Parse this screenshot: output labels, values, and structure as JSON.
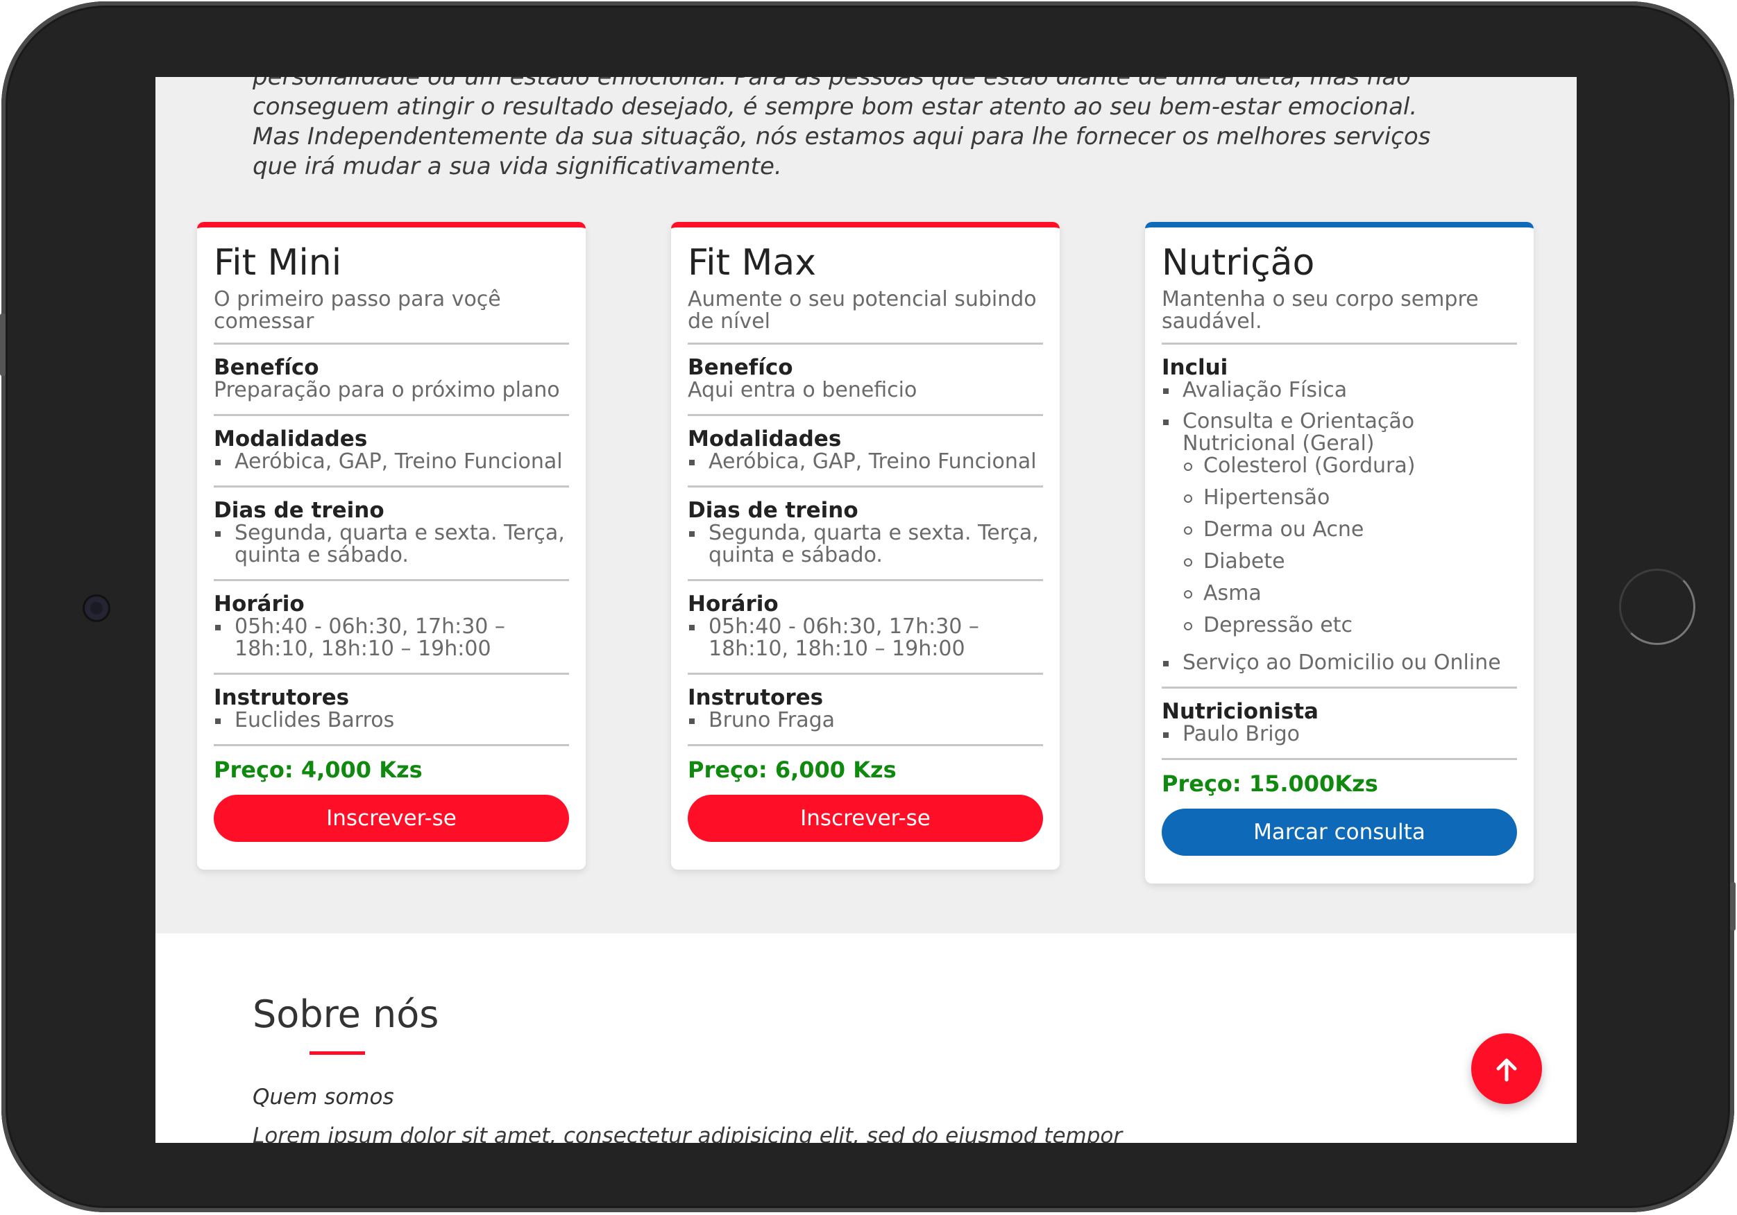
{
  "intro": {
    "lines": [
      "personalidade ou um estado emocional. Para as pessoas que estão diante de uma dieta, mas não",
      "conseguem atingir o resultado desejado, é sempre bom estar atento ao seu bem-estar emocional.",
      "Mas Independentemente da sua situação, nós estamos aqui para lhe fornecer os melhores serviços",
      "que irá mudar a sua vida significativamente."
    ]
  },
  "plans": [
    {
      "title": "Fit Mini",
      "subtitle": "O primeiro passo para voçê comessar",
      "benefit_heading": "Benefíco",
      "benefit_text": "Preparação para o próximo plano",
      "modalities_heading": "Modalidades",
      "modalities": "Aeróbica, GAP, Treino Funcional",
      "days_heading": "Dias de treino",
      "days": "Segunda, quarta e sexta. Terça, quinta e sábado.",
      "hours_heading": "Horário",
      "hours": "05h:40 - 06h:30, 17h:30 – 18h:10, 18h:10 – 19h:00",
      "instructors_heading": "Instrutores",
      "instructor": "Euclides Barros",
      "price": "Preço: 4,000 Kzs",
      "button": "Inscrever-se",
      "accent": "#ff0f27"
    },
    {
      "title": "Fit Max",
      "subtitle": "Aumente o seu potencial subindo de nível",
      "benefit_heading": "Benefíco",
      "benefit_text": "Aqui entra o beneficio",
      "modalities_heading": "Modalidades",
      "modalities": "Aeróbica, GAP, Treino Funcional",
      "days_heading": "Dias de treino",
      "days": "Segunda, quarta e sexta. Terça, quinta e sábado.",
      "hours_heading": "Horário",
      "hours": "05h:40 - 06h:30, 17h:30 – 18h:10, 18h:10 – 19h:00",
      "instructors_heading": "Instrutores",
      "instructor": "Bruno Fraga",
      "price": "Preço: 6,000 Kzs",
      "button": "Inscrever-se",
      "accent": "#ff0f27"
    }
  ],
  "nutrition": {
    "title": "Nutrição",
    "subtitle": "Mantenha o seu corpo sempre saudável.",
    "includes_heading": "Inclui",
    "include_1": "Avaliação Física",
    "include_2": "Consulta e Orientação Nutricional (Geral)",
    "conditions": [
      "Colesterol (Gordura)",
      "Hipertensão",
      "Derma ou Acne",
      "Diabete",
      "Asma",
      "Depressão etc"
    ],
    "include_3": "Serviço ao Domicilio ou Online",
    "nutritionist_heading": "Nutricionista",
    "nutritionist": "Paulo Brigo",
    "price": "Preço: 15.000Kzs",
    "button": "Marcar consulta",
    "accent": "#0e6ab8"
  },
  "about": {
    "title": "Sobre nós",
    "subtitle": "Quem somos",
    "text": "Lorem ipsum dolor sit amet, consectetur adipisicing elit, sed do eiusmod tempor"
  },
  "fab": {
    "icon": "arrow-up-icon",
    "glyph": "🡑"
  },
  "colors": {
    "accent_red": "#ff0f27",
    "accent_blue": "#0e6ab8",
    "price_green": "#0f8a0f"
  }
}
